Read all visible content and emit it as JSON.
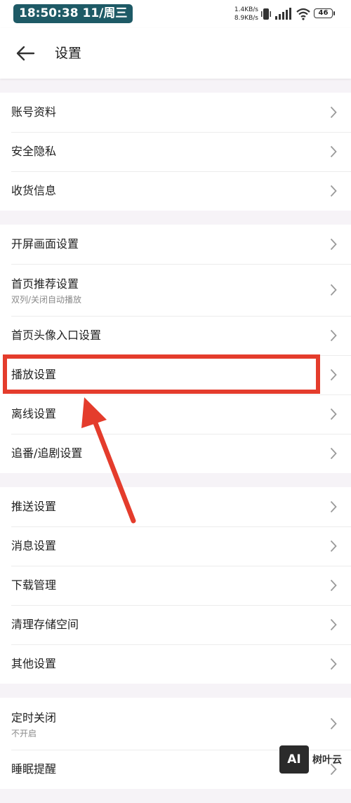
{
  "status_bar": {
    "time": "18:50:38 11/周三",
    "upload_speed": "1.4KB/s",
    "download_speed": "8.9KB/s",
    "battery_level": "46",
    "icons": [
      "vibrate-icon",
      "signal-icon",
      "wifi-icon",
      "battery-icon"
    ]
  },
  "header": {
    "back_icon": "arrow-left-icon",
    "title": "设置"
  },
  "groups": [
    {
      "items": [
        {
          "label": "账号资料",
          "subtitle": ""
        },
        {
          "label": "安全隐私",
          "subtitle": ""
        },
        {
          "label": "收货信息",
          "subtitle": ""
        }
      ]
    },
    {
      "items": [
        {
          "label": "开屏画面设置",
          "subtitle": ""
        },
        {
          "label": "首页推荐设置",
          "subtitle": "双列/关闭自动播放"
        },
        {
          "label": "首页头像入口设置",
          "subtitle": ""
        },
        {
          "label": "播放设置",
          "subtitle": "",
          "highlighted": true
        },
        {
          "label": "离线设置",
          "subtitle": ""
        },
        {
          "label": "追番/追剧设置",
          "subtitle": ""
        }
      ]
    },
    {
      "items": [
        {
          "label": "推送设置",
          "subtitle": ""
        },
        {
          "label": "消息设置",
          "subtitle": ""
        },
        {
          "label": "下载管理",
          "subtitle": ""
        },
        {
          "label": "清理存储空间",
          "subtitle": ""
        },
        {
          "label": "其他设置",
          "subtitle": ""
        }
      ]
    },
    {
      "items": [
        {
          "label": "定时关闭",
          "subtitle": "不开启"
        },
        {
          "label": "睡眠提醒",
          "subtitle": ""
        }
      ]
    }
  ],
  "annotation": {
    "color": "#e43c2c",
    "target": "播放设置"
  },
  "watermark": {
    "logo_text": "AI",
    "name": "树叶云"
  },
  "colors": {
    "page_background": "#f6f3f7",
    "row_background": "#ffffff",
    "time_pill": "#1e5a66"
  }
}
